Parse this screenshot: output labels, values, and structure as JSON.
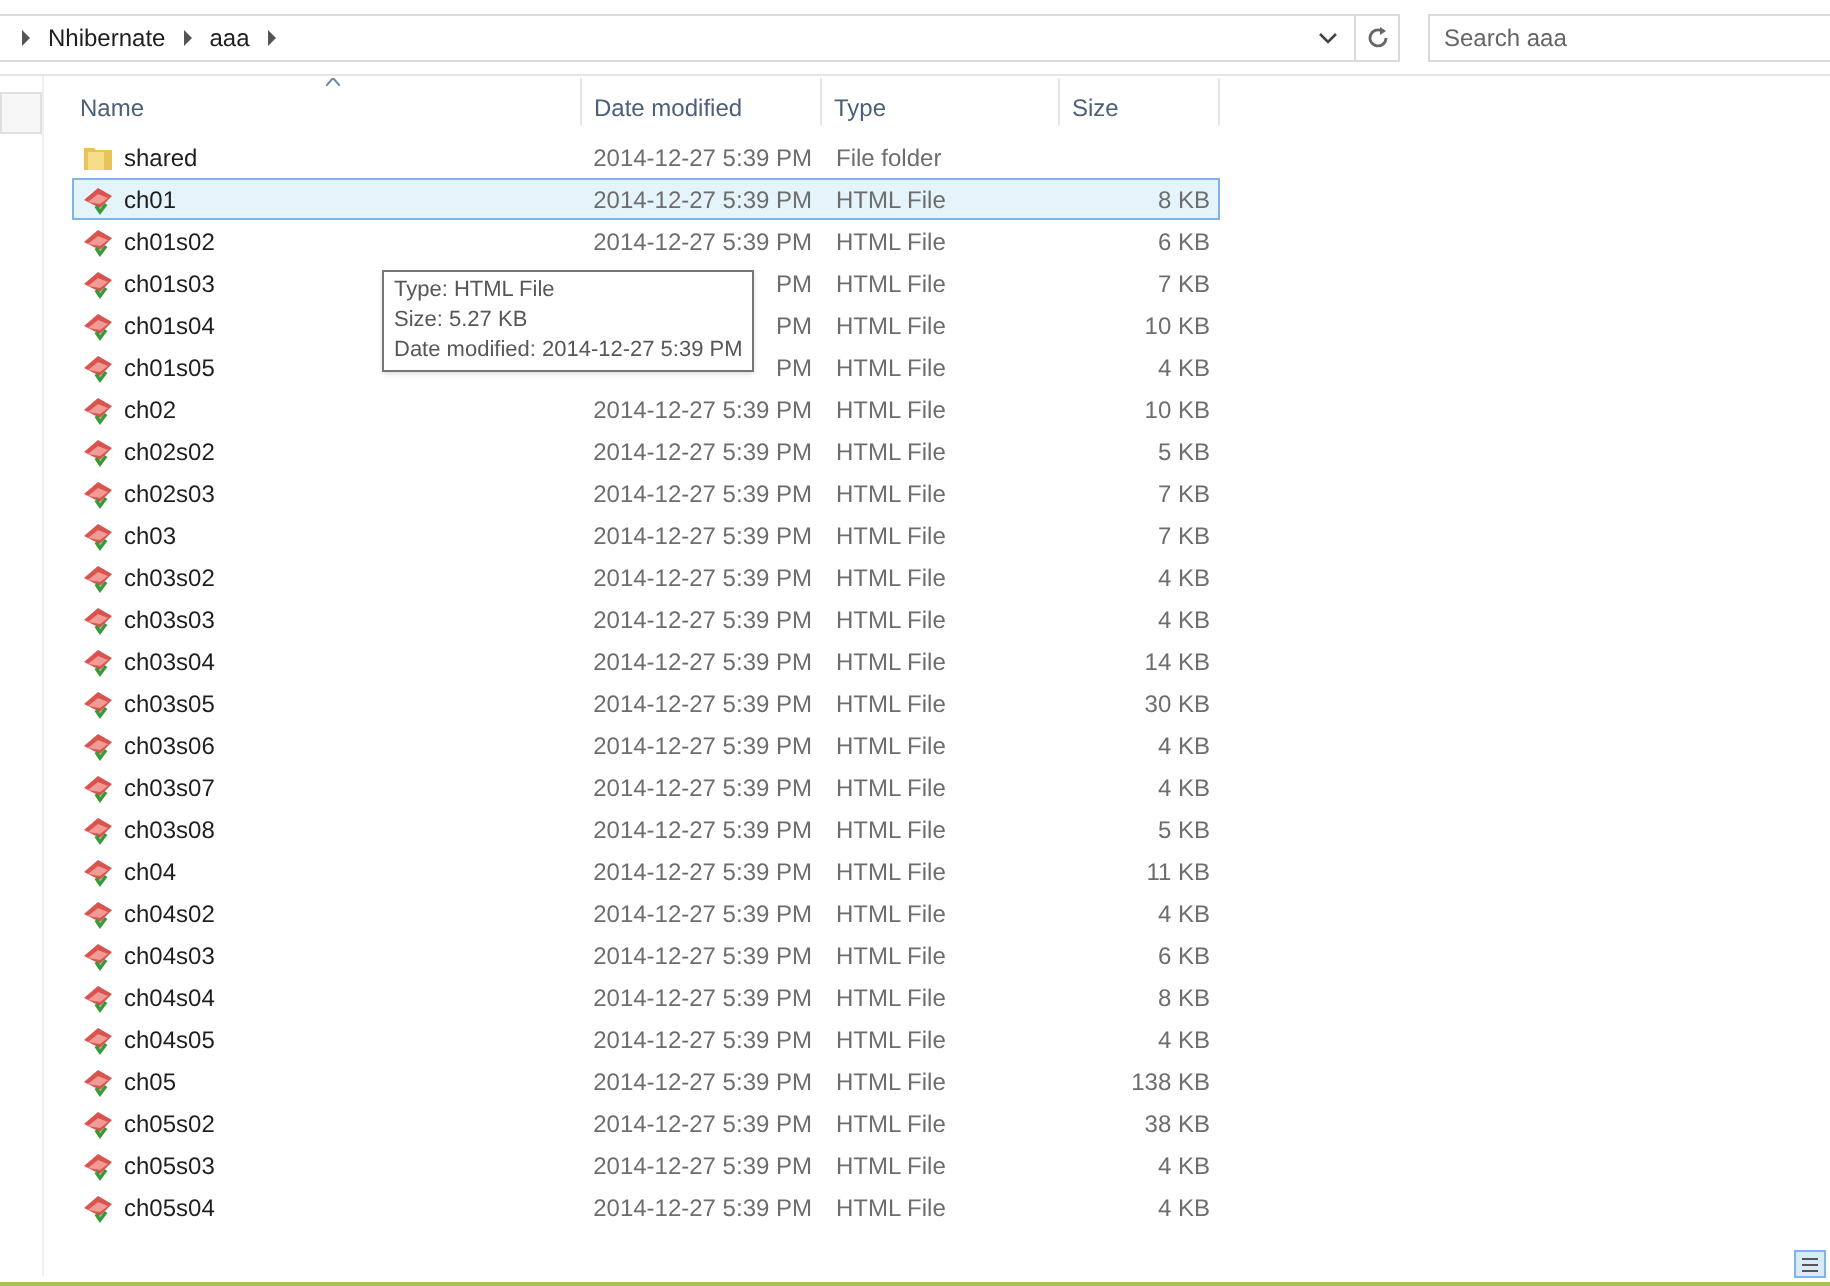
{
  "address_bar": {
    "crumbs": [
      "Nhibernate",
      "aaa"
    ]
  },
  "search": {
    "placeholder": "Search aaa"
  },
  "columns": [
    {
      "label": "Name",
      "sorted": true
    },
    {
      "label": "Date modified",
      "sorted": false
    },
    {
      "label": "Type",
      "sorted": false
    },
    {
      "label": "Size",
      "sorted": false
    }
  ],
  "rows": [
    {
      "kind": "folder",
      "name": "shared",
      "date": "2014-12-27 5:39 PM",
      "type": "File folder",
      "size": "",
      "selected": false
    },
    {
      "kind": "file",
      "name": "ch01",
      "date": "2014-12-27 5:39 PM",
      "type": "HTML File",
      "size": "8 KB",
      "selected": true
    },
    {
      "kind": "file",
      "name": "ch01s02",
      "date": "2014-12-27 5:39 PM",
      "type": "HTML File",
      "size": "6 KB",
      "selected": false
    },
    {
      "kind": "file",
      "name": "ch01s03",
      "date": "PM",
      "type": "HTML File",
      "size": "7 KB",
      "selected": false
    },
    {
      "kind": "file",
      "name": "ch01s04",
      "date": "PM",
      "type": "HTML File",
      "size": "10 KB",
      "selected": false
    },
    {
      "kind": "file",
      "name": "ch01s05",
      "date": "PM",
      "type": "HTML File",
      "size": "4 KB",
      "selected": false
    },
    {
      "kind": "file",
      "name": "ch02",
      "date": "2014-12-27 5:39 PM",
      "type": "HTML File",
      "size": "10 KB",
      "selected": false
    },
    {
      "kind": "file",
      "name": "ch02s02",
      "date": "2014-12-27 5:39 PM",
      "type": "HTML File",
      "size": "5 KB",
      "selected": false
    },
    {
      "kind": "file",
      "name": "ch02s03",
      "date": "2014-12-27 5:39 PM",
      "type": "HTML File",
      "size": "7 KB",
      "selected": false
    },
    {
      "kind": "file",
      "name": "ch03",
      "date": "2014-12-27 5:39 PM",
      "type": "HTML File",
      "size": "7 KB",
      "selected": false
    },
    {
      "kind": "file",
      "name": "ch03s02",
      "date": "2014-12-27 5:39 PM",
      "type": "HTML File",
      "size": "4 KB",
      "selected": false
    },
    {
      "kind": "file",
      "name": "ch03s03",
      "date": "2014-12-27 5:39 PM",
      "type": "HTML File",
      "size": "4 KB",
      "selected": false
    },
    {
      "kind": "file",
      "name": "ch03s04",
      "date": "2014-12-27 5:39 PM",
      "type": "HTML File",
      "size": "14 KB",
      "selected": false
    },
    {
      "kind": "file",
      "name": "ch03s05",
      "date": "2014-12-27 5:39 PM",
      "type": "HTML File",
      "size": "30 KB",
      "selected": false
    },
    {
      "kind": "file",
      "name": "ch03s06",
      "date": "2014-12-27 5:39 PM",
      "type": "HTML File",
      "size": "4 KB",
      "selected": false
    },
    {
      "kind": "file",
      "name": "ch03s07",
      "date": "2014-12-27 5:39 PM",
      "type": "HTML File",
      "size": "4 KB",
      "selected": false
    },
    {
      "kind": "file",
      "name": "ch03s08",
      "date": "2014-12-27 5:39 PM",
      "type": "HTML File",
      "size": "5 KB",
      "selected": false
    },
    {
      "kind": "file",
      "name": "ch04",
      "date": "2014-12-27 5:39 PM",
      "type": "HTML File",
      "size": "11 KB",
      "selected": false
    },
    {
      "kind": "file",
      "name": "ch04s02",
      "date": "2014-12-27 5:39 PM",
      "type": "HTML File",
      "size": "4 KB",
      "selected": false
    },
    {
      "kind": "file",
      "name": "ch04s03",
      "date": "2014-12-27 5:39 PM",
      "type": "HTML File",
      "size": "6 KB",
      "selected": false
    },
    {
      "kind": "file",
      "name": "ch04s04",
      "date": "2014-12-27 5:39 PM",
      "type": "HTML File",
      "size": "8 KB",
      "selected": false
    },
    {
      "kind": "file",
      "name": "ch04s05",
      "date": "2014-12-27 5:39 PM",
      "type": "HTML File",
      "size": "4 KB",
      "selected": false
    },
    {
      "kind": "file",
      "name": "ch05",
      "date": "2014-12-27 5:39 PM",
      "type": "HTML File",
      "size": "138 KB",
      "selected": false
    },
    {
      "kind": "file",
      "name": "ch05s02",
      "date": "2014-12-27 5:39 PM",
      "type": "HTML File",
      "size": "38 KB",
      "selected": false
    },
    {
      "kind": "file",
      "name": "ch05s03",
      "date": "2014-12-27 5:39 PM",
      "type": "HTML File",
      "size": "4 KB",
      "selected": false
    },
    {
      "kind": "file",
      "name": "ch05s04",
      "date": "2014-12-27 5:39 PM",
      "type": "HTML File",
      "size": "4 KB",
      "selected": false
    }
  ],
  "tooltip": {
    "lines": [
      "Type: HTML File",
      "Size: 5.27 KB",
      "Date modified: 2014-12-27 5:39 PM"
    ]
  }
}
